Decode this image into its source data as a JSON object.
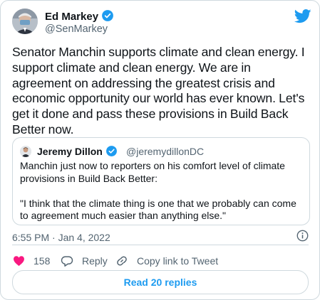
{
  "author": {
    "name": "Ed Markey",
    "handle": "@SenMarkey"
  },
  "tweet": {
    "text": "Senator Manchin supports climate and clean energy. I support climate and clean energy. We are in agreement on addressing the greatest crisis and economic opportunity our world has ever known. Let's get it done and pass these provisions in Build Back Better now."
  },
  "quote": {
    "name": "Jeremy Dillon",
    "handle": "@jeremydillonDC",
    "paragraph1": "Manchin just now to reporters on his comfort level of climate provisions in Build Back Better:",
    "paragraph2": "\"I think that the climate thing is one that we probably can come to agreement much easier than anything else.\""
  },
  "meta": {
    "timestamp": "6:55 PM · Jan 4, 2022"
  },
  "actions": {
    "like_count": "158",
    "reply_label": "Reply",
    "copy_link_label": "Copy link to Tweet"
  },
  "read_replies_label": "Read 20 replies",
  "colors": {
    "accent": "#1d9bf0",
    "like_red": "#f91880",
    "muted": "#536471",
    "border": "#cfd9de"
  },
  "icons": [
    "verified-badge-icon",
    "twitter-bird-icon",
    "info-icon",
    "heart-icon",
    "reply-bubble-icon",
    "link-icon"
  ]
}
